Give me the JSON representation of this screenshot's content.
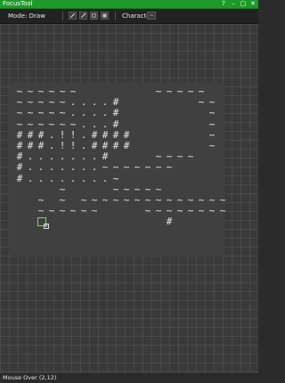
{
  "window": {
    "title": "FocusTool",
    "controls": [
      "?",
      "–",
      "▢",
      "✕"
    ]
  },
  "toolbar": {
    "mode_label": "Mode: Draw",
    "character_label": "Character:",
    "character_value": "~",
    "tools": [
      {
        "name": "pencil-tool",
        "icon": "pencil-icon"
      },
      {
        "name": "eyedropper-tool",
        "icon": "eyedropper-icon"
      },
      {
        "name": "rectangle-tool",
        "icon": "rectangle-icon"
      },
      {
        "name": "fill-tool",
        "icon": "fill-icon"
      }
    ]
  },
  "map": {
    "rows": [
      "~~~~~~       ~~~~~ ",
      "~~~~~....#       ~~",
      "~~~~~....#        ~",
      "~~~~~~...#        ~",
      "###.!!.####       ~",
      "###.!!.####       ~",
      "#.......#    ~~~~ ",
      "#.......~~~~~~~   ",
      "#........~         ",
      "    ~    ~~~~~     ",
      "  ~ ~ ~~~~~~~~~~~~~~",
      "  ~~~~~~    ~~~~~~~~",
      "              #    "
    ]
  },
  "status": {
    "mouse_over": "Mouse Over (2,12)"
  }
}
